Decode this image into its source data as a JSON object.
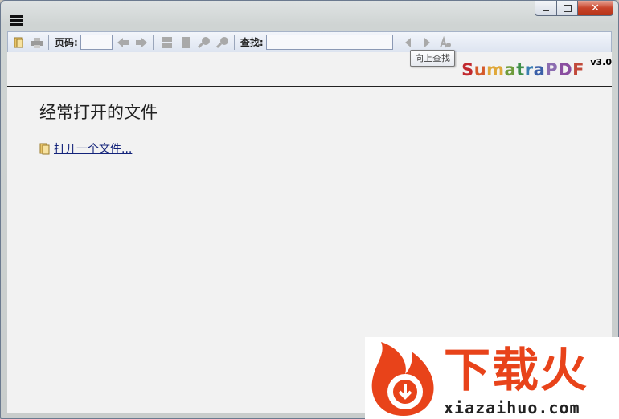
{
  "window": {
    "controls": {
      "minimize": "minimize-icon",
      "maximize": "maximize-icon",
      "close": "✕"
    }
  },
  "toolbar": {
    "page_label": "页码:",
    "page_value": "",
    "find_label": "查找:",
    "find_value": "",
    "tooltip": "向上查找"
  },
  "about": {
    "logo": [
      {
        "ch": "S",
        "color": "#c1292e"
      },
      {
        "ch": "u",
        "color": "#d55a2a"
      },
      {
        "ch": "m",
        "color": "#e0a83a"
      },
      {
        "ch": "a",
        "color": "#6e9b3a"
      },
      {
        "ch": "t",
        "color": "#3f8f4a"
      },
      {
        "ch": "r",
        "color": "#3a7fb3"
      },
      {
        "ch": "a",
        "color": "#3a5fa8"
      },
      {
        "ch": "P",
        "color": "#8c6db0"
      },
      {
        "ch": "D",
        "color": "#8a4ea0"
      },
      {
        "ch": "F",
        "color": "#c14a3a"
      }
    ],
    "version": "v3.0"
  },
  "content": {
    "frequent_title": "经常打开的文件",
    "open_file_link": "打开一个文件..."
  },
  "watermark": {
    "brand": "下载火",
    "url": "xiazaihuo.com",
    "colors": {
      "orange": "#e8431a"
    }
  }
}
